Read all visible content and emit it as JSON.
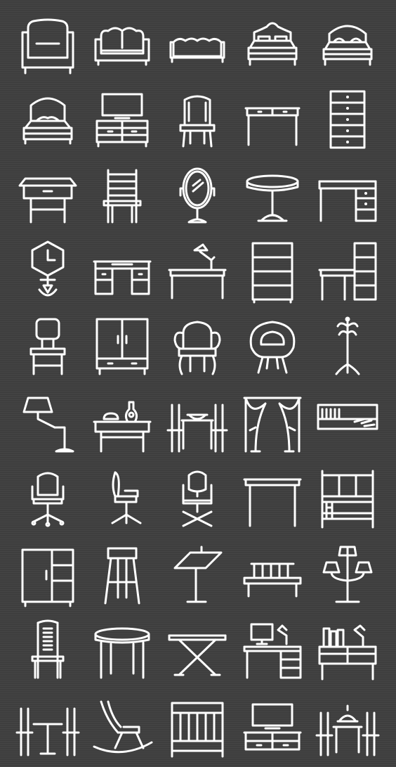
{
  "icon_color": "#ffffff",
  "background_color": "#3e3e3e",
  "rows": [
    [
      "armchair-icon",
      "sofa-icon",
      "couch-icon",
      "double-bed-icon",
      "double-bed-alt-icon"
    ],
    [
      "single-bed-icon",
      "tv-stand-icon",
      "dining-chair-icon",
      "console-table-icon",
      "chest-of-drawers-icon"
    ],
    [
      "writing-desk-icon",
      "ladder-back-chair-icon",
      "dressing-mirror-icon",
      "round-table-icon",
      "office-desk-icon"
    ],
    [
      "wall-clock-icon",
      "computer-desk-icon",
      "desk-with-lamp-icon",
      "bookshelf-icon",
      "desk-and-shelf-icon"
    ],
    [
      "side-chair-icon",
      "wardrobe-icon",
      "wingback-chair-icon",
      "egg-chair-icon",
      "coat-rack-icon"
    ],
    [
      "floor-lamp-icon",
      "table-with-vase-icon",
      "dining-set-icon",
      "curtains-icon",
      "wall-shelf-icon"
    ],
    [
      "office-chair-icon",
      "ergonomic-chair-icon",
      "swivel-chair-icon",
      "simple-table-icon",
      "bunk-bed-icon"
    ],
    [
      "cabinet-icon",
      "bar-stool-icon",
      "drafting-table-icon",
      "bench-icon",
      "chandelier-lamp-icon"
    ],
    [
      "high-back-chair-icon",
      "round-side-table-icon",
      "folding-table-icon",
      "workstation-icon",
      "study-desk-icon"
    ],
    [
      "bistro-table-icon",
      "rocking-chair-icon",
      "crib-icon",
      "tv-unit-icon",
      "dining-table-lamp-icon"
    ]
  ]
}
